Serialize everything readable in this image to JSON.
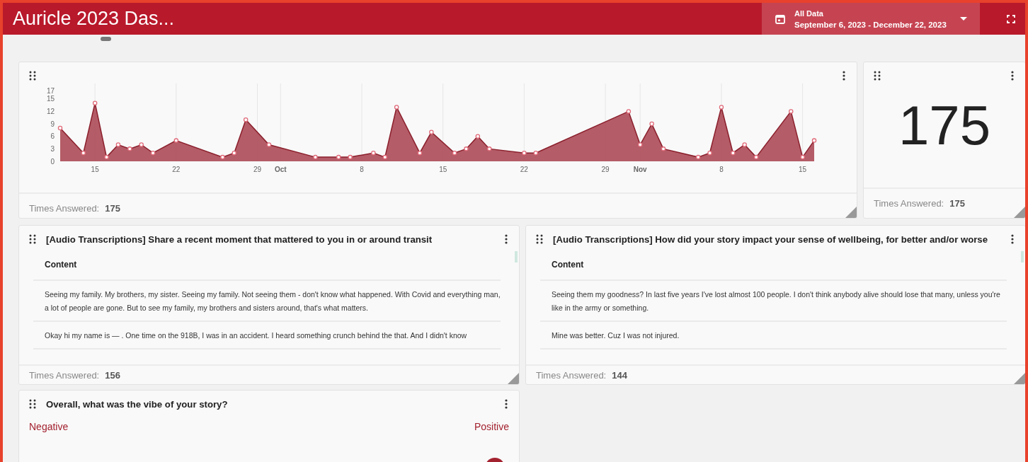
{
  "header": {
    "title": "Auricle 2023 Das...",
    "date_filter": {
      "label": "All Data",
      "range": "September 6, 2023 - December 22, 2023"
    }
  },
  "timeline_card": {
    "chart_data": {
      "type": "area",
      "categories": [
        null,
        null,
        null,
        "15",
        null,
        null,
        null,
        null,
        null,
        null,
        "22",
        null,
        null,
        null,
        null,
        null,
        null,
        "29",
        null,
        "Oct",
        null,
        null,
        null,
        null,
        null,
        null,
        "8",
        null,
        null,
        null,
        null,
        null,
        null,
        "15",
        null,
        null,
        null,
        null,
        null,
        null,
        "22",
        null,
        null,
        null,
        null,
        null,
        null,
        "29",
        null,
        null,
        "Nov",
        null,
        null,
        null,
        null,
        null,
        null,
        "8",
        null,
        null,
        null,
        null,
        null,
        null,
        "15",
        null
      ],
      "grid": true,
      "series": [
        {
          "color": "#a8414e",
          "values": [
            8,
            null,
            2,
            14,
            1,
            4,
            3,
            4,
            2,
            null,
            5,
            null,
            null,
            null,
            1,
            2,
            10,
            null,
            4,
            null,
            null,
            null,
            1,
            null,
            1,
            1,
            null,
            2,
            1,
            13,
            null,
            2,
            7,
            null,
            2,
            3,
            6,
            3,
            null,
            null,
            2,
            2,
            null,
            null,
            null,
            null,
            null,
            null,
            null,
            12,
            4,
            9,
            3,
            null,
            null,
            1,
            2,
            13,
            2,
            4,
            1,
            null,
            null,
            12,
            1,
            5
          ]
        }
      ],
      "ylim": [
        0,
        17
      ],
      "yticks": [
        0,
        3,
        6,
        9,
        12,
        15,
        17
      ]
    },
    "footer_label": "Times Answered:",
    "footer_value": "175"
  },
  "count_card": {
    "value": "175",
    "footer_label": "Times Answered:",
    "footer_value": "175"
  },
  "transcription_cards": [
    {
      "title": "[Audio Transcriptions] Share a recent moment that mattered to you in or around transit",
      "column": "Content",
      "rows": [
        "Seeing my family. My brothers, my sister. Seeing my family. Not seeing them - don't know what happened. With Covid and everything man, a lot of people are gone. But to see my family, my brothers and sisters around, that's what matters.",
        "Okay hi my name is — . One time on the 918B, I was in an accident. I heard something crunch behind the that. And I didn't know"
      ],
      "footer_label": "Times Answered:",
      "footer_value": "156"
    },
    {
      "title": "[Audio Transcriptions] How did your story impact your sense of wellbeing, for better and/or worse",
      "column": "Content",
      "rows": [
        "Seeing them my goodness? In last five years I've lost almost 100 people. I don't think anybody alive should lose that many, unless you're like in the army or something.",
        "Mine was better. Cuz I was not injured."
      ],
      "footer_label": "Times Answered:",
      "footer_value": "144"
    }
  ],
  "vibe_card": {
    "title": "Overall, what was the vibe of your story?",
    "low_label": "Negative",
    "high_label": "Positive",
    "level": 0.97
  }
}
